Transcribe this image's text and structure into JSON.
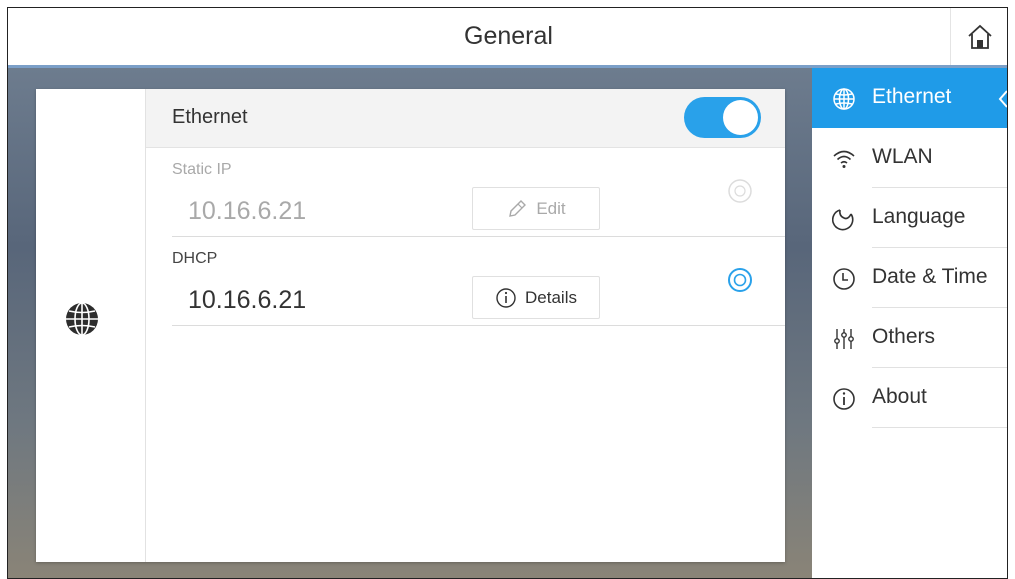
{
  "header": {
    "title": "General"
  },
  "ethernet": {
    "label": "Ethernet",
    "enabled": true,
    "options": [
      {
        "label": "Static IP",
        "ip": "10.16.6.21",
        "button_label": "Edit",
        "selected": false
      },
      {
        "label": "DHCP",
        "ip": "10.16.6.21",
        "button_label": "Details",
        "selected": true
      }
    ]
  },
  "sidebar": {
    "items": [
      {
        "label": "Ethernet",
        "icon": "globe-icon",
        "active": true
      },
      {
        "label": "WLAN",
        "icon": "wifi-icon"
      },
      {
        "label": "Language",
        "icon": "language-icon"
      },
      {
        "label": "Date & Time",
        "icon": "clock-icon"
      },
      {
        "label": "Others",
        "icon": "sliders-icon"
      },
      {
        "label": "About",
        "icon": "info-icon"
      }
    ]
  },
  "colors": {
    "accent": "#1f9be8",
    "toggle": "#29a1ea",
    "header_border": "#7b9fc8"
  }
}
